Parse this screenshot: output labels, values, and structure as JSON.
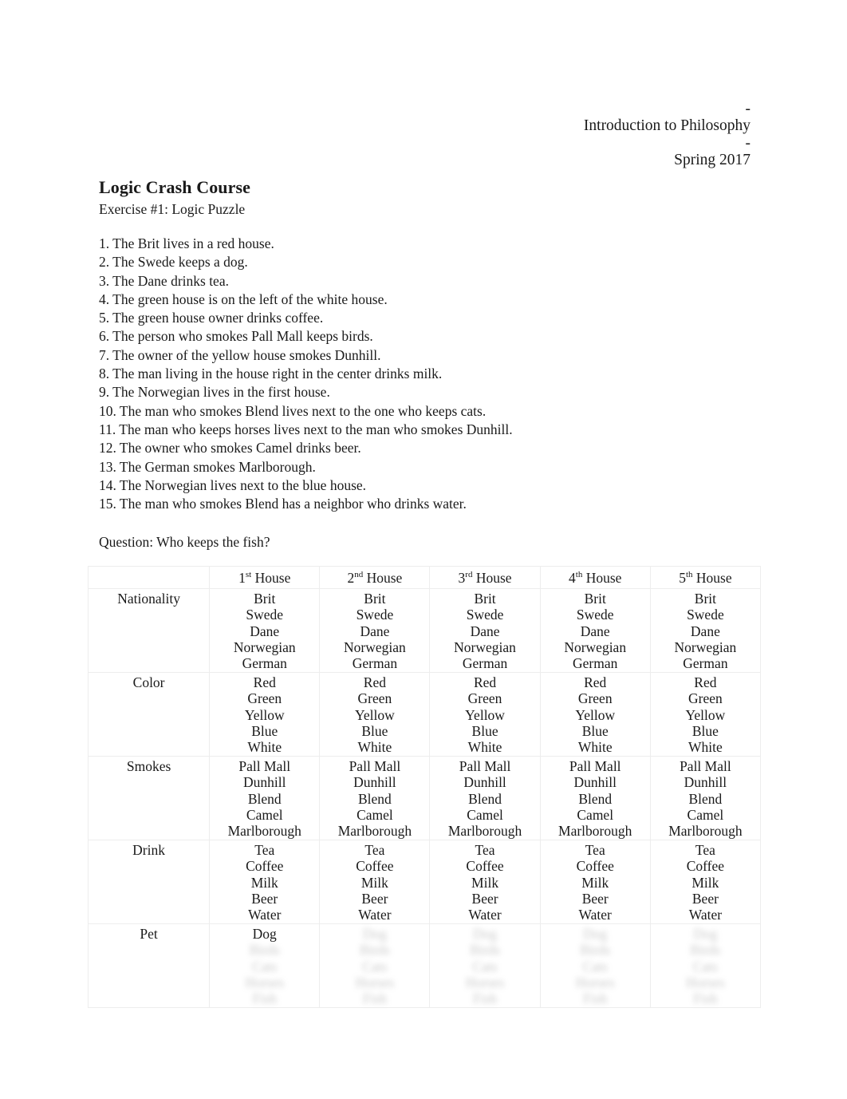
{
  "header": {
    "dash": "-",
    "course": "Introduction to Philosophy",
    "term": "Spring 2017"
  },
  "title": "Logic Crash Course",
  "exercise_label": "Exercise #1: Logic Puzzle",
  "clues": [
    "1. The Brit lives in a red house.",
    "2. The Swede keeps a dog.",
    "3. The Dane drinks tea.",
    "4. The green house is on the left of the white house.",
    "5. The green house owner drinks coffee.",
    "6. The person who smokes Pall Mall keeps birds.",
    "7. The owner of the yellow house smokes Dunhill.",
    "8. The man living in the house right in the center drinks milk.",
    "9. The Norwegian lives in the first house.",
    "10. The man who smokes Blend lives next to the one who keeps cats.",
    "11. The man who keeps horses lives next to the man who smokes Dunhill.",
    "12. The owner who smokes Camel drinks beer.",
    "13. The German smokes Marlborough.",
    "14. The Norwegian lives next to the blue house.",
    "15. The man who smokes Blend has a neighbor who drinks water."
  ],
  "question": "Question: Who keeps the fish?",
  "table": {
    "corner_label": "",
    "columns": [
      {
        "num": "1",
        "ord": "st",
        "word": "House"
      },
      {
        "num": "2",
        "ord": "nd",
        "word": "House"
      },
      {
        "num": "3",
        "ord": "rd",
        "word": "House"
      },
      {
        "num": "4",
        "ord": "th",
        "word": "House"
      },
      {
        "num": "5",
        "ord": "th",
        "word": "House"
      }
    ],
    "rows": [
      {
        "label": "Nationality",
        "options": [
          "Brit",
          "Swede",
          "Dane",
          "Norwegian",
          "German"
        ],
        "obscured": false
      },
      {
        "label": "Color",
        "options": [
          "Red",
          "Green",
          "Yellow",
          "Blue",
          "White"
        ],
        "obscured": false
      },
      {
        "label": "Smokes",
        "options": [
          "Pall Mall",
          "Dunhill",
          "Blend",
          "Camel",
          "Marlborough"
        ],
        "obscured": false
      },
      {
        "label": "Drink",
        "options": [
          "Tea",
          "Coffee",
          "Milk",
          "Beer",
          "Water"
        ],
        "obscured": false
      },
      {
        "label": "Pet",
        "options": [
          "Dog",
          "Birds",
          "Cats",
          "Horses",
          "Fish"
        ],
        "obscured": true,
        "obscured_from": 1,
        "first_cell_visible_only": true
      }
    ]
  },
  "colors": {
    "text": "#1a1a1a",
    "table_border": "#ededed",
    "page_background": "#ffffff"
  }
}
